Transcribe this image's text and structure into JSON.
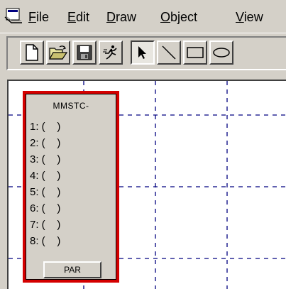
{
  "menubar": {
    "items": [
      {
        "label": "File",
        "underline": "F",
        "rest": "ile"
      },
      {
        "label": "Edit",
        "underline": "E",
        "rest": "dit"
      },
      {
        "label": "Draw",
        "underline": "D",
        "rest": "raw"
      },
      {
        "label": "Object",
        "underline": "O",
        "rest": "bject"
      },
      {
        "label": "View",
        "underline": "V",
        "rest": "iew"
      }
    ]
  },
  "toolbar": {
    "buttons": [
      {
        "icon": "new-document-icon"
      },
      {
        "icon": "open-folder-icon"
      },
      {
        "icon": "save-disk-icon"
      },
      {
        "icon": "run-icon"
      },
      {
        "icon": "select-arrow-icon",
        "pressed": true
      },
      {
        "icon": "line-tool-icon"
      },
      {
        "icon": "rectangle-tool-icon"
      },
      {
        "icon": "ellipse-tool-icon"
      }
    ]
  },
  "panel": {
    "title": "MMSTC-",
    "slots": [
      "1: (    )",
      "2: (    )",
      "3: (    )",
      "4: (    )",
      "5: (    )",
      "6: (    )",
      "7: (    )",
      "8: (    )"
    ],
    "button_label": "PAR"
  },
  "colors": {
    "face": "#d4d0c8",
    "selection_border": "#d40000",
    "grid_line": "#000080"
  }
}
